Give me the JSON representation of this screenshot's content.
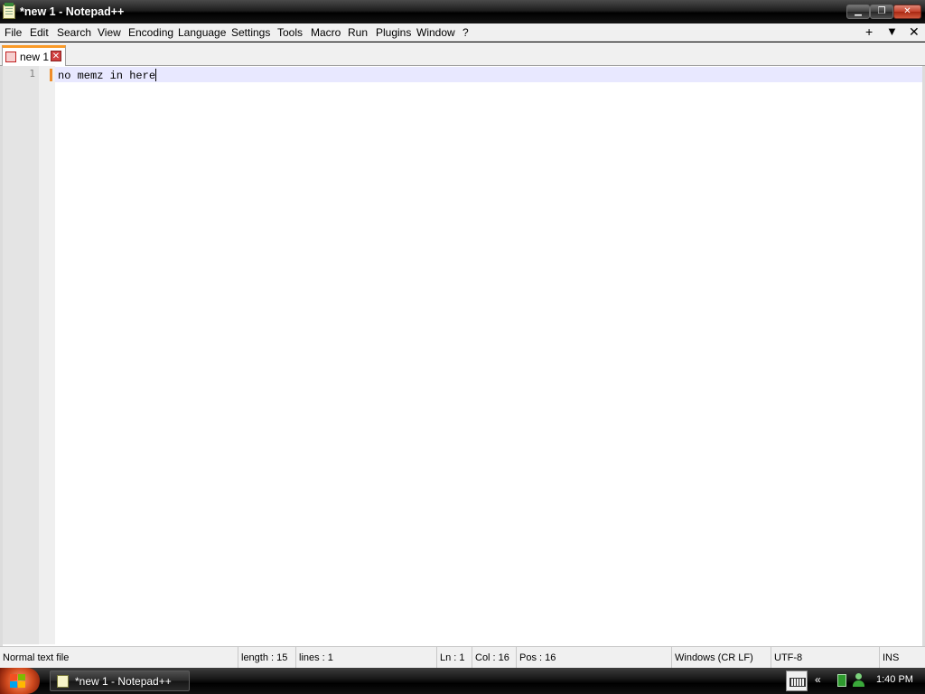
{
  "window": {
    "title": "*new 1 - Notepad++",
    "buttons": {
      "minimize": "▁",
      "maximize": "❐",
      "close": "✕"
    }
  },
  "menu": {
    "items": [
      "File",
      "Edit",
      "Search",
      "View",
      "Encoding",
      "Language",
      "Settings",
      "Tools",
      "Macro",
      "Run",
      "Plugins",
      "Window",
      "?"
    ],
    "right": {
      "add": "+",
      "dropdown": "▼",
      "close": "✕"
    }
  },
  "tabs": [
    {
      "label": "new 1",
      "close": "✕",
      "icon": "unsaved-document-icon",
      "active": true
    }
  ],
  "editor": {
    "line_numbers": [
      "1"
    ],
    "lines": [
      "no memz in here"
    ]
  },
  "status": {
    "file_type": "Normal text file",
    "length": "length : 15",
    "lines": "lines : 1",
    "ln": "Ln : 1",
    "col": "Col : 16",
    "pos": "Pos : 16",
    "eol": "Windows (CR LF)",
    "encoding": "UTF-8",
    "mode": "INS"
  },
  "taskbar": {
    "task_label": "*new 1 - Notepad++",
    "tray_chevron": "«",
    "clock": "1:40 PM"
  },
  "colors": {
    "tab_accent": "#fa9a28",
    "current_line": "#e8e8ff",
    "close_button": "#c4402a"
  }
}
